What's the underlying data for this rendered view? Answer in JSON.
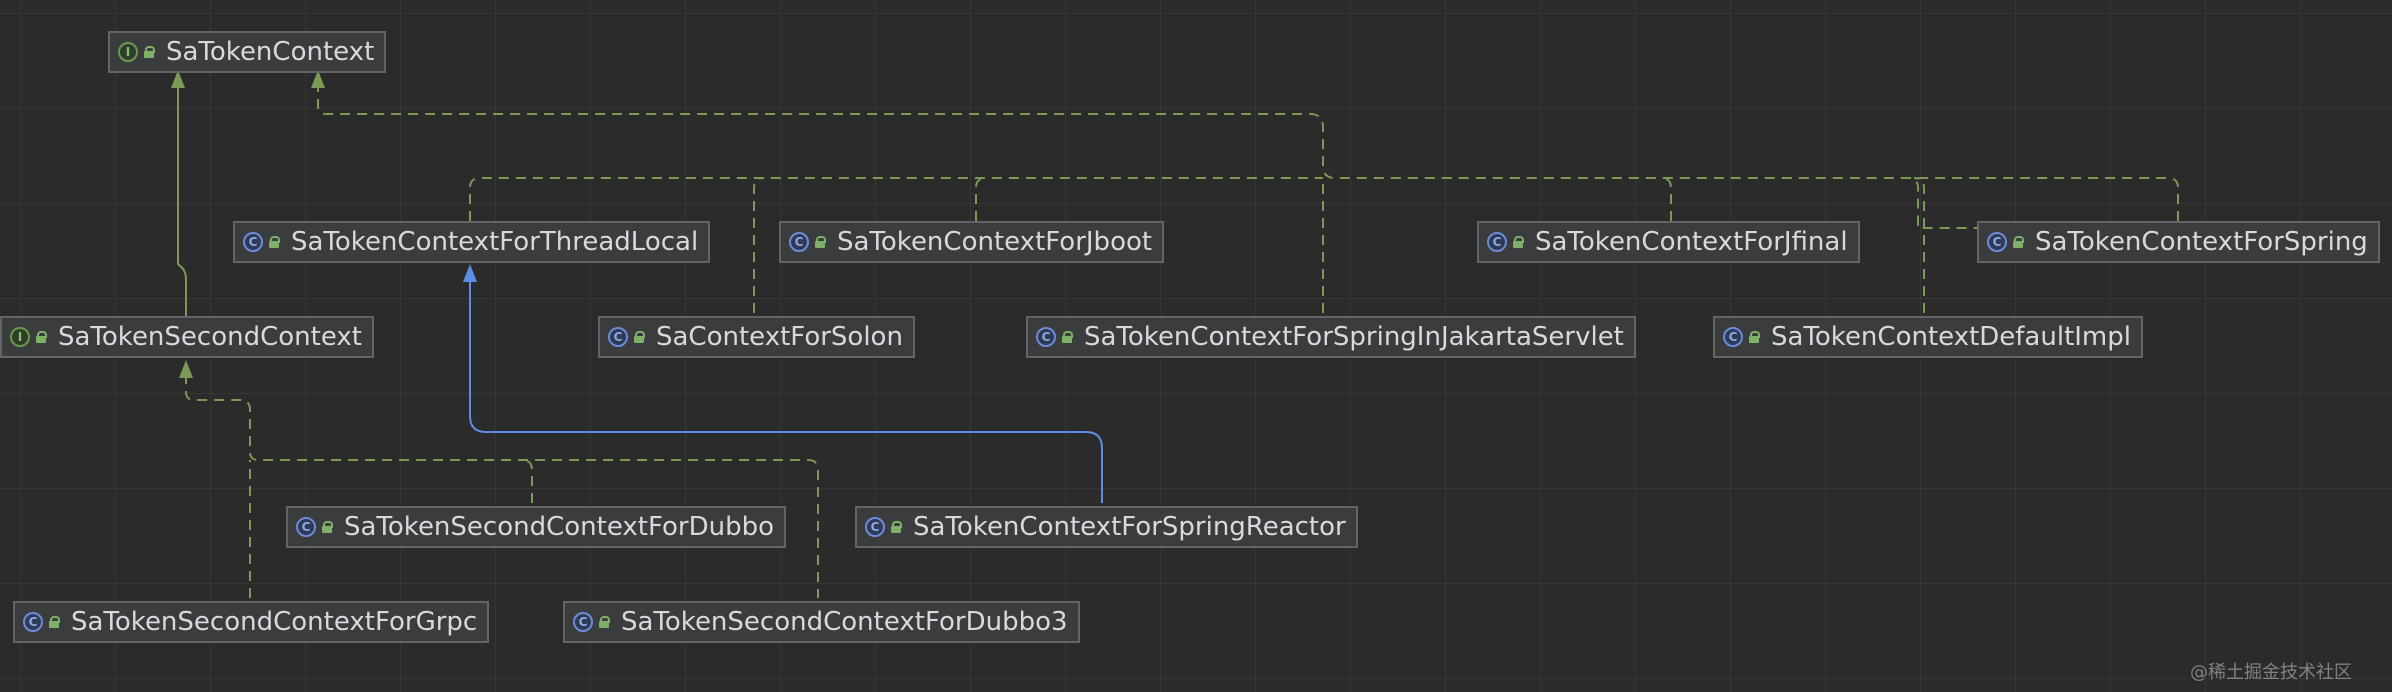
{
  "colors": {
    "background": "#2b2b2c",
    "implements_edge": "#7a9a55",
    "extends_edge": "#5f8de6",
    "class_icon": "#6d8bd8",
    "interface_icon": "#6a9a4f"
  },
  "nodes": [
    {
      "id": "ctx",
      "label": "SaTokenContext",
      "kind": "interface",
      "icon": "interface-icon"
    },
    {
      "id": "tl",
      "label": "SaTokenContextForThreadLocal",
      "kind": "class",
      "icon": "class-icon"
    },
    {
      "id": "jboot",
      "label": "SaTokenContextForJboot",
      "kind": "class",
      "icon": "class-icon"
    },
    {
      "id": "jfinal",
      "label": "SaTokenContextForJfinal",
      "kind": "class",
      "icon": "class-icon"
    },
    {
      "id": "spring",
      "label": "SaTokenContextForSpring",
      "kind": "class",
      "icon": "class-icon"
    },
    {
      "id": "second",
      "label": "SaTokenSecondContext",
      "kind": "interface",
      "icon": "interface-icon"
    },
    {
      "id": "solon",
      "label": "SaContextForSolon",
      "kind": "class",
      "icon": "class-icon"
    },
    {
      "id": "jakarta",
      "label": "SaTokenContextForSpringInJakartaServlet",
      "kind": "class",
      "icon": "class-icon"
    },
    {
      "id": "default",
      "label": "SaTokenContextDefaultImpl",
      "kind": "class",
      "icon": "class-icon"
    },
    {
      "id": "dubbo",
      "label": "SaTokenSecondContextForDubbo",
      "kind": "class",
      "icon": "class-icon"
    },
    {
      "id": "reactor",
      "label": "SaTokenContextForSpringReactor",
      "kind": "class",
      "icon": "class-icon"
    },
    {
      "id": "grpc",
      "label": "SaTokenSecondContextForGrpc",
      "kind": "class",
      "icon": "class-icon"
    },
    {
      "id": "dubbo3",
      "label": "SaTokenSecondContextForDubbo3",
      "kind": "class",
      "icon": "class-icon"
    }
  ],
  "edges": [
    {
      "from": "second",
      "to": "ctx",
      "type": "extends"
    },
    {
      "from": "tl",
      "to": "ctx",
      "type": "implements"
    },
    {
      "from": "jboot",
      "to": "ctx",
      "type": "implements"
    },
    {
      "from": "jfinal",
      "to": "ctx",
      "type": "implements"
    },
    {
      "from": "spring",
      "to": "ctx",
      "type": "implements"
    },
    {
      "from": "solon",
      "to": "ctx",
      "type": "implements"
    },
    {
      "from": "jakarta",
      "to": "ctx",
      "type": "implements"
    },
    {
      "from": "default",
      "to": "ctx",
      "type": "implements"
    },
    {
      "from": "dubbo",
      "to": "second",
      "type": "implements"
    },
    {
      "from": "grpc",
      "to": "second",
      "type": "implements"
    },
    {
      "from": "dubbo3",
      "to": "second",
      "type": "implements"
    },
    {
      "from": "reactor",
      "to": "tl",
      "type": "extends"
    }
  ],
  "watermark": "@稀土掘金技术社区"
}
